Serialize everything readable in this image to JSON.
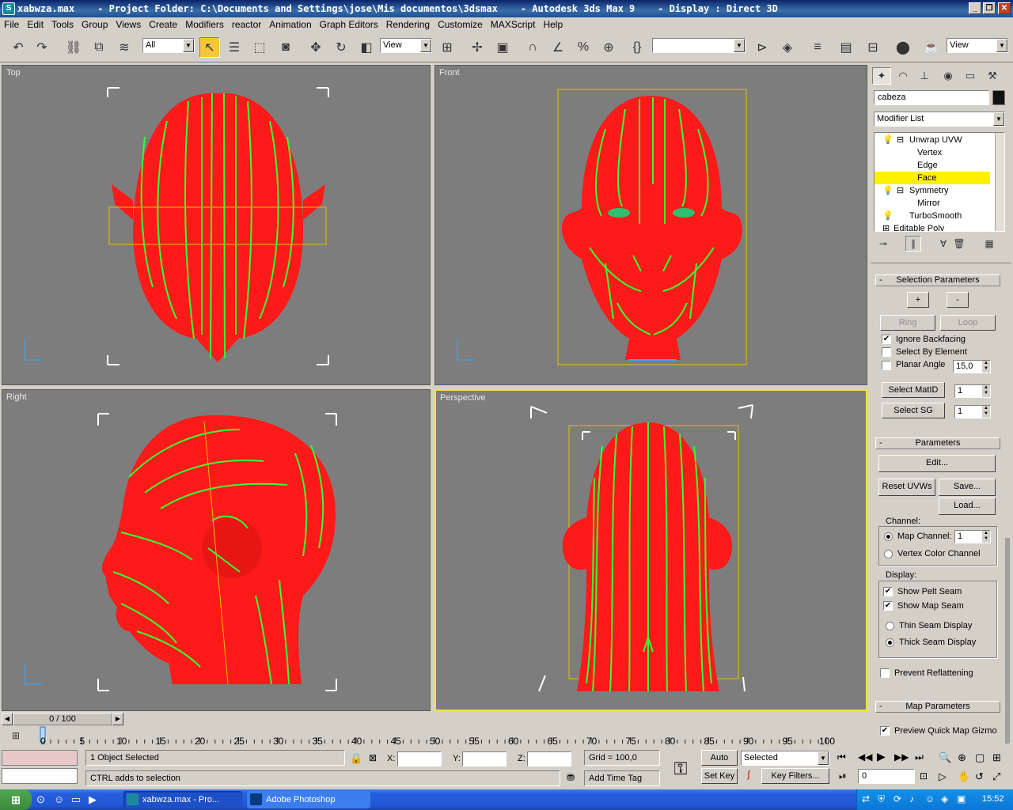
{
  "window": {
    "title": "xabwza.max    - Project Folder: C:\\Documents and Settings\\jose\\Mis documentos\\3dsmax    - Autodesk 3ds Max 9    - Display : Direct 3D",
    "min": "_",
    "max": "❐",
    "close": "✕"
  },
  "menu": [
    "File",
    "Edit",
    "Tools",
    "Group",
    "Views",
    "Create",
    "Modifiers",
    "reactor",
    "Animation",
    "Graph Editors",
    "Rendering",
    "Customize",
    "MAXScript",
    "Help"
  ],
  "toolbar": {
    "selection_filter": "All",
    "ref_coord": "View",
    "named_selection": "",
    "render_view": "View"
  },
  "viewports": {
    "top": "Top",
    "front": "Front",
    "right": "Right",
    "perspective": "Perspective"
  },
  "command_panel": {
    "object_name": "cabeza",
    "object_color": "#111111",
    "modifier_list": "Modifier List",
    "stack": [
      {
        "label": "Unwrap UVW",
        "level": 0,
        "box": "⊟",
        "bulb": true
      },
      {
        "label": "Vertex",
        "level": 1
      },
      {
        "label": "Edge",
        "level": 1
      },
      {
        "label": "Face",
        "level": 1,
        "selected": true
      },
      {
        "label": "Symmetry",
        "level": 0,
        "box": "⊟",
        "bulb": true
      },
      {
        "label": "Mirror",
        "level": 1
      },
      {
        "label": "TurboSmooth",
        "level": 0,
        "bulb": true
      },
      {
        "label": "Editable Poly",
        "level": 0,
        "box": "⊞"
      }
    ],
    "selection_parameters": {
      "header": "Selection Parameters",
      "plus": "+",
      "minus": "-",
      "ring": "Ring",
      "loop": "Loop",
      "ignore_backfacing": "Ignore Backfacing",
      "select_by_element": "Select By Element",
      "planar_angle": "Planar Angle",
      "planar_angle_value": "15,0",
      "select_matid": "Select MatID",
      "select_matid_value": "1",
      "select_sg": "Select SG",
      "select_sg_value": "1"
    },
    "parameters": {
      "header": "Parameters",
      "edit": "Edit...",
      "reset_uvws": "Reset UVWs",
      "save": "Save...",
      "load": "Load...",
      "channel": "Channel:",
      "map_channel": "Map Channel:",
      "map_channel_value": "1",
      "vertex_color_channel": "Vertex Color Channel",
      "display": "Display:",
      "show_pelt_seam": "Show Pelt Seam",
      "show_map_seam": "Show Map Seam",
      "thin_seam": "Thin Seam Display",
      "thick_seam": "Thick Seam Display",
      "prevent_reflattening": "Prevent Reflattening"
    },
    "map_parameters": {
      "header": "Map Parameters",
      "preview_quick_map_gizmo": "Preview Quick Map Gizmo"
    }
  },
  "timeline": {
    "frame": "0 / 100",
    "ticks": [
      "0",
      "5",
      "10",
      "15",
      "20",
      "25",
      "30",
      "35",
      "40",
      "45",
      "50",
      "55",
      "60",
      "65",
      "70",
      "75",
      "80",
      "85",
      "90",
      "95",
      "100"
    ]
  },
  "status": {
    "selected": "1 Object Selected",
    "prompt": "CTRL adds to selection",
    "x_label": "X:",
    "y_label": "Y:",
    "z_label": "Z:",
    "grid": "Grid = 100,0",
    "add_time_tag": "Add Time Tag",
    "auto_key": "Auto Key",
    "set_key": "Set Key",
    "selected_combo": "Selected",
    "key_filters": "Key Filters...",
    "frame_field": "0"
  },
  "taskbar": {
    "tasks": [
      "xabwza.max    - Pro...",
      "Adobe Photoshop"
    ],
    "clock": "15:52"
  }
}
